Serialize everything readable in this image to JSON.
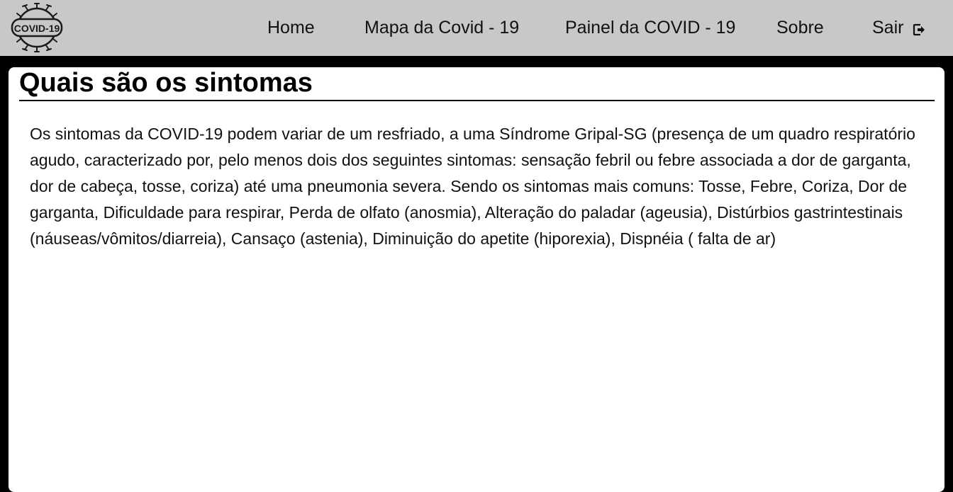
{
  "header": {
    "logo_text": "COVID-19",
    "nav": {
      "home": "Home",
      "mapa": "Mapa da Covid - 19",
      "painel": "Painel da COVID - 19",
      "sobre": "Sobre",
      "sair": "Sair"
    },
    "exit_icon": "sign-out-icon"
  },
  "main": {
    "title": "Quais são os sintomas",
    "paragraph": "Os sintomas da COVID-19 podem variar de um resfriado, a uma Síndrome Gripal-SG (presença de um quadro respiratório agudo, caracterizado por, pelo menos dois dos seguintes sintomas: sensação febril ou febre associada a dor de garganta, dor de cabeça, tosse, coriza) até uma pneumonia severa. Sendo os sintomas mais comuns: Tosse, Febre, Coriza, Dor de garganta, Dificuldade para respirar, Perda de olfato (anosmia), Alteração do paladar (ageusia), Distúrbios gastrintestinais (náuseas/vômitos/diarreia), Cansaço (astenia), Diminuição do apetite (hiporexia), Dispnéia ( falta de ar)"
  },
  "colors": {
    "navbar_bg": "#c8c8c8",
    "page_bg": "#000000",
    "content_bg": "#ffffff"
  }
}
